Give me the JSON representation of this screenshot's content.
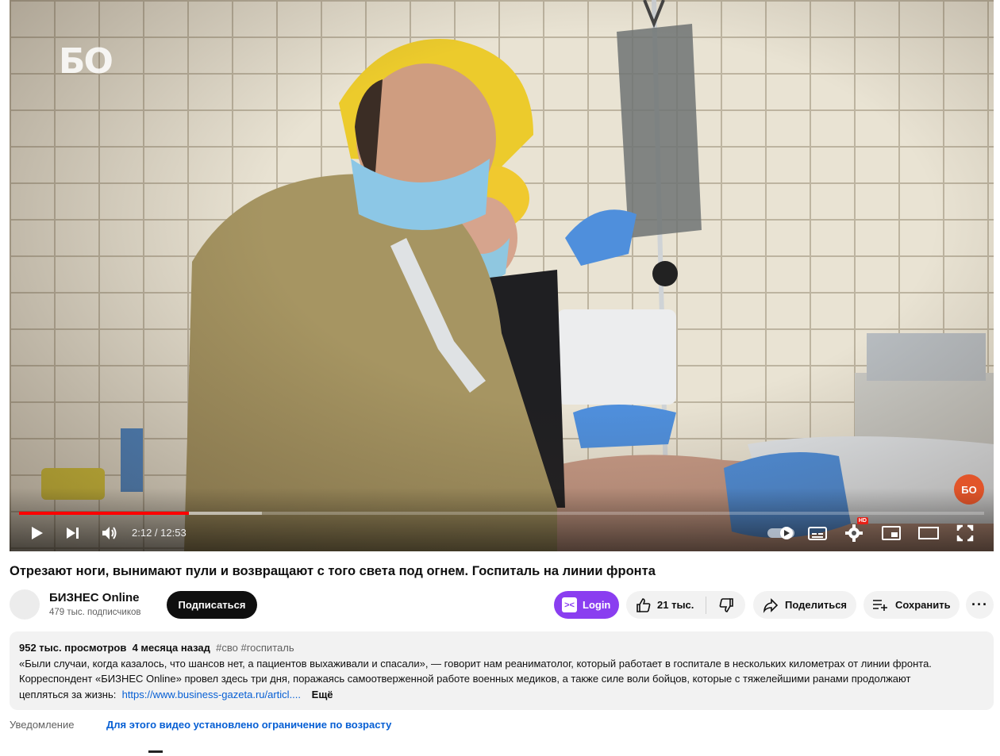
{
  "player": {
    "watermark": "БО",
    "channel_bug": "БО",
    "time_display": "2:12 / 12:53",
    "progress_played_fraction": 0.176,
    "progress_buffered_fraction": 0.252,
    "controls": [
      "play-icon",
      "next-icon",
      "volume-icon",
      "autoplay-toggle-icon",
      "subtitles-icon",
      "settings-icon",
      "miniplayer-icon",
      "theater-icon",
      "fullscreen-icon"
    ],
    "hd_badge": "HD"
  },
  "video": {
    "title": "Отрезают ноги, вынимают пули и возвращают с того света под огнем. Госпиталь на линии фронта"
  },
  "channel": {
    "name": "БИЗНЕС Online",
    "subscribers": "479 тыс. подписчиков",
    "subscribe_label": "Подписаться"
  },
  "actions": {
    "login_label": "Login",
    "likes": "21 тыс.",
    "share_label": "Поделиться",
    "save_label": "Сохранить",
    "more_label": "···"
  },
  "description": {
    "views": "952 тыс. просмотров",
    "age": "4 месяца назад",
    "tags": "#сво #госпиталь",
    "line1": "«Были случаи, когда казалось, что шансов нет, а пациентов выхаживали и спасали», — говорит нам реаниматолог, который работает в госпитале в нескольких километрах от линии фронта.",
    "line2": "Корреспондент «БИЗНЕС Online» провел здесь три дня, поражаясь самоотверженной работе военных медиков, а также силе воли бойцов, которые с тяжелейшими ранами продолжают",
    "line3": "цепляться за жизнь:",
    "link": "https://www.business-gazeta.ru/articl....",
    "more": "Ещё"
  },
  "notice": {
    "label": "Уведомление",
    "text": "Для этого видео установлено ограничение по возрасту"
  },
  "colors": {
    "accent_red": "#ff0000",
    "login_purple": "#8a3ef0",
    "link_blue": "#065fd4"
  }
}
